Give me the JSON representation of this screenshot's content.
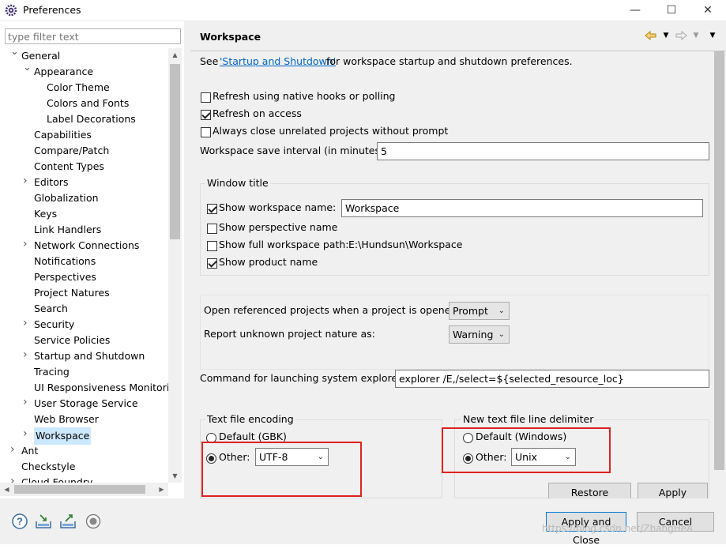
{
  "window": {
    "title": "Preferences",
    "minimize": "—",
    "maximize": "☐",
    "close": "✕"
  },
  "left": {
    "filter_placeholder": "type filter text",
    "tree": [
      {
        "label": "General",
        "depth": 0,
        "twisty": "open"
      },
      {
        "label": "Appearance",
        "depth": 1,
        "twisty": "open"
      },
      {
        "label": "Color Theme",
        "depth": 2,
        "twisty": ""
      },
      {
        "label": "Colors and Fonts",
        "depth": 2,
        "twisty": ""
      },
      {
        "label": "Label Decorations",
        "depth": 2,
        "twisty": ""
      },
      {
        "label": "Capabilities",
        "depth": 1,
        "twisty": ""
      },
      {
        "label": "Compare/Patch",
        "depth": 1,
        "twisty": ""
      },
      {
        "label": "Content Types",
        "depth": 1,
        "twisty": ""
      },
      {
        "label": "Editors",
        "depth": 1,
        "twisty": "closed"
      },
      {
        "label": "Globalization",
        "depth": 1,
        "twisty": ""
      },
      {
        "label": "Keys",
        "depth": 1,
        "twisty": ""
      },
      {
        "label": "Link Handlers",
        "depth": 1,
        "twisty": ""
      },
      {
        "label": "Network Connections",
        "depth": 1,
        "twisty": "closed"
      },
      {
        "label": "Notifications",
        "depth": 1,
        "twisty": ""
      },
      {
        "label": "Perspectives",
        "depth": 1,
        "twisty": ""
      },
      {
        "label": "Project Natures",
        "depth": 1,
        "twisty": ""
      },
      {
        "label": "Search",
        "depth": 1,
        "twisty": ""
      },
      {
        "label": "Security",
        "depth": 1,
        "twisty": "closed"
      },
      {
        "label": "Service Policies",
        "depth": 1,
        "twisty": ""
      },
      {
        "label": "Startup and Shutdown",
        "depth": 1,
        "twisty": "closed"
      },
      {
        "label": "Tracing",
        "depth": 1,
        "twisty": ""
      },
      {
        "label": "UI Responsiveness Monitorin",
        "depth": 1,
        "twisty": ""
      },
      {
        "label": "User Storage Service",
        "depth": 1,
        "twisty": "closed"
      },
      {
        "label": "Web Browser",
        "depth": 1,
        "twisty": ""
      },
      {
        "label": "Workspace",
        "depth": 1,
        "twisty": "closed",
        "selected": true
      },
      {
        "label": "Ant",
        "depth": 0,
        "twisty": "closed"
      },
      {
        "label": "Checkstyle",
        "depth": 0,
        "twisty": ""
      },
      {
        "label": "Cloud Foundry",
        "depth": 0,
        "twisty": "closed"
      }
    ]
  },
  "page": {
    "title": "Workspace",
    "see_prefix": "See ",
    "see_link": "'Startup and Shutdown'",
    "see_suffix": " for workspace startup and shutdown preferences.",
    "refresh_native": "Refresh using native hooks or polling",
    "refresh_access": "Refresh on access",
    "always_close": "Always close unrelated projects without prompt",
    "save_interval_label": "Workspace save interval (in minutes):",
    "save_interval_value": "5",
    "window_title_group": "Window title",
    "show_ws_name": "Show workspace name:",
    "ws_name_value": "Workspace",
    "show_perspective": "Show perspective name",
    "show_full_path": "Show full workspace path:",
    "full_path_value": "E:\\Hundsun\\Workspace",
    "show_product": "Show product name",
    "open_ref_label": "Open referenced projects when a project is opened:",
    "open_ref_value": "Prompt",
    "report_unknown_label": "Report unknown project nature as:",
    "report_unknown_value": "Warning",
    "explorer_label": "Command for launching system explorer:",
    "explorer_value": "explorer /E,/select=${selected_resource_loc}",
    "encoding_group": "Text file encoding",
    "enc_default": "Default (GBK)",
    "enc_other": "Other:",
    "enc_value": "UTF-8",
    "delim_group": "New text file line delimiter",
    "delim_default": "Default (Windows)",
    "delim_other": "Other:",
    "delim_value": "Unix",
    "restore_defaults": "Restore Defaults",
    "apply": "Apply"
  },
  "footer": {
    "apply_close": "Apply and Close",
    "cancel": "Cancel",
    "watermark": "https://blog.csdn.net/ZhangHeA"
  },
  "icons": {
    "back": "back-arrow-icon",
    "forward": "forward-arrow-icon",
    "menu": "view-menu-icon",
    "help": "help-icon",
    "import": "import-icon",
    "export": "export-icon",
    "record": "oomph-record-icon"
  },
  "colors": {
    "selection": "#cce8ff",
    "link": "#0066cc",
    "highlight_box": "#e02020",
    "default_button_border": "#0078d7"
  }
}
